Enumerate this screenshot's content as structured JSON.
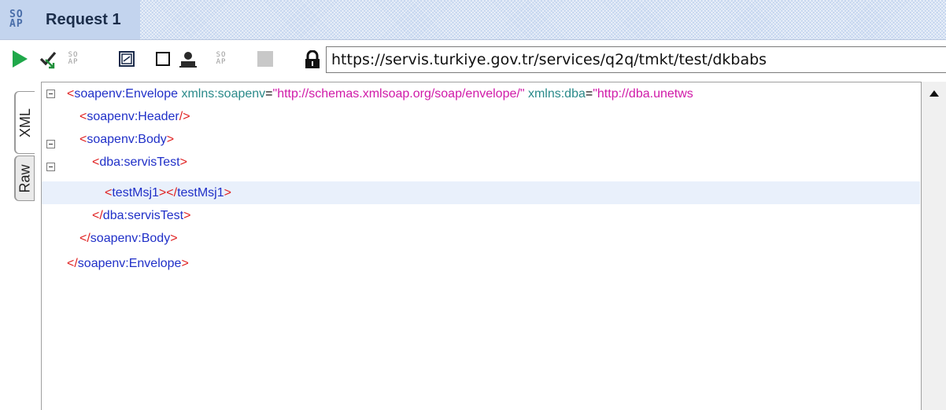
{
  "title_bar": {
    "logo_text_top": "SO",
    "logo_text_bottom": "AP",
    "title": "Request 1"
  },
  "toolbar": {
    "icons": [
      "play-icon",
      "check-arrow-icon",
      "soap-small-icon",
      "window-icon",
      "checkbox-icon",
      "user-icon",
      "soap-small-icon",
      "stop-icon",
      "lock-icon"
    ],
    "endpoint_url": "https://servis.turkiye.gov.tr/services/q2q/tmkt/test/dkbabs"
  },
  "side_tabs": {
    "xml_label": "XML",
    "raw_label": "Raw",
    "active": "XML"
  },
  "editor": {
    "lines": [
      {
        "open": "<",
        "tag": "soapenv:Envelope",
        "attr1": "xmlns:soapenv",
        "val1": "\"http://schemas.xmlsoap.org/soap/envelope/\"",
        "attr2": "xmlns:dba",
        "val2": "\"http://dba.unetws",
        "close": ""
      },
      {
        "open": "<",
        "tag": "soapenv:Header",
        "close": "/>"
      },
      {
        "open": "<",
        "tag": "soapenv:Body",
        "close": ">"
      },
      {
        "open": "<",
        "tag": "dba:servisTest",
        "close": ">"
      },
      {
        "open": "<",
        "tag": "testMsj1",
        "mid": "></",
        "tag2": "testMsj1",
        "close": ">"
      },
      {
        "open": "</",
        "tag": "dba:servisTest",
        "close": ">"
      },
      {
        "open": "</",
        "tag": "soapenv:Body",
        "close": ">"
      },
      {
        "open": "</",
        "tag": "soapenv:Envelope",
        "close": ">"
      }
    ],
    "highlighted_line": 5
  },
  "colors": {
    "bracket": "#e02020",
    "tag": "#2030c8",
    "attribute": "#2a8a8a",
    "attribute_value": "#d01aa8",
    "play": "#1fa84a",
    "titlebar": "#c3d4ee"
  }
}
